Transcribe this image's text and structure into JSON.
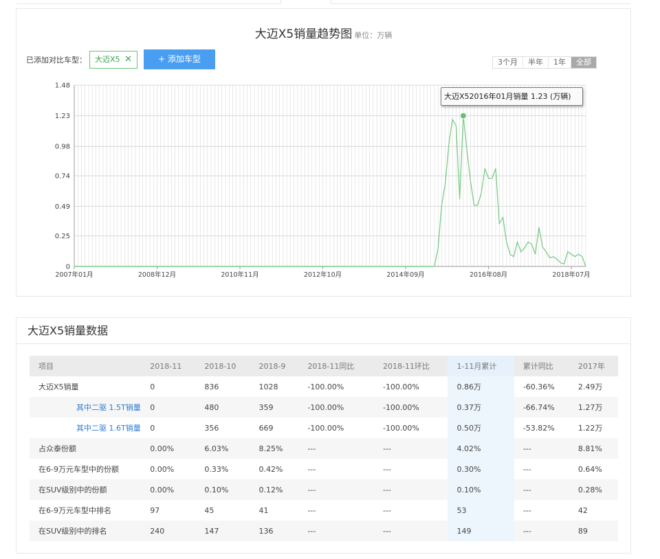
{
  "chart_header": {
    "title": "大迈X5销量趋势图",
    "unit": "单位：万辆",
    "compare_label": "已添加对比车型：",
    "tag_label": "大迈X5",
    "tag_close": "✕",
    "add_button": "+ 添加车型",
    "ranges": [
      "3个月",
      "半年",
      "1年",
      "全部"
    ]
  },
  "tooltip": "大迈X52016年01月销量 1.23 (万辆)",
  "chart_data": {
    "type": "line",
    "title": "大迈X5销量趋势图",
    "ylabel": "万辆",
    "ylim": [
      0,
      1.48
    ],
    "y_ticks": [
      "0",
      "0.25",
      "0.49",
      "0.74",
      "0.98",
      "1.23",
      "1.48"
    ],
    "y_tick_values": [
      0,
      0.25,
      0.49,
      0.74,
      0.98,
      1.23,
      1.48
    ],
    "x_ticks": [
      "2007年01月",
      "2008年12月",
      "2010年11月",
      "2012年10月",
      "2014年09月",
      "2016年08月",
      "2018年07月"
    ],
    "x_start": "2007-01",
    "x_end": "2018-11",
    "grid": true,
    "series": [
      {
        "name": "大迈X5",
        "color": "#7acb89",
        "points": [
          [
            "2015-05",
            0
          ],
          [
            "2015-06",
            0.15
          ],
          [
            "2015-07",
            0.5
          ],
          [
            "2015-08",
            0.68
          ],
          [
            "2015-09",
            1.0
          ],
          [
            "2015-10",
            1.2
          ],
          [
            "2015-11",
            1.15
          ],
          [
            "2015-12",
            0.55
          ],
          [
            "2016-01",
            1.23
          ],
          [
            "2016-02",
            0.95
          ],
          [
            "2016-03",
            0.7
          ],
          [
            "2016-04",
            0.5
          ],
          [
            "2016-05",
            0.5
          ],
          [
            "2016-06",
            0.6
          ],
          [
            "2016-07",
            0.8
          ],
          [
            "2016-08",
            0.72
          ],
          [
            "2016-09",
            0.72
          ],
          [
            "2016-10",
            0.8
          ],
          [
            "2016-11",
            0.35
          ],
          [
            "2016-12",
            0.4
          ],
          [
            "2017-01",
            0.2
          ],
          [
            "2017-02",
            0.1
          ],
          [
            "2017-03",
            0.08
          ],
          [
            "2017-04",
            0.2
          ],
          [
            "2017-05",
            0.12
          ],
          [
            "2017-06",
            0.15
          ],
          [
            "2017-07",
            0.2
          ],
          [
            "2017-08",
            0.18
          ],
          [
            "2017-09",
            0.1
          ],
          [
            "2017-10",
            0.32
          ],
          [
            "2017-11",
            0.16
          ],
          [
            "2017-12",
            0.12
          ],
          [
            "2018-01",
            0.07
          ],
          [
            "2018-02",
            0.08
          ],
          [
            "2018-03",
            0.06
          ],
          [
            "2018-04",
            0.03
          ],
          [
            "2018-05",
            0.02
          ],
          [
            "2018-06",
            0.12
          ],
          [
            "2018-07",
            0.1
          ],
          [
            "2018-08",
            0.08
          ],
          [
            "2018-09",
            0.1
          ],
          [
            "2018-10",
            0.08
          ],
          [
            "2018-11",
            0
          ]
        ]
      }
    ],
    "highlight": [
      "2016-01",
      1.23
    ]
  },
  "table_title": "大迈X5销量数据",
  "table": {
    "headers": [
      "项目",
      "2018-11",
      "2018-10",
      "2018-9",
      "2018-11同比",
      "2018-11环比",
      "1-11月累计",
      "累计同比",
      "2017年"
    ],
    "rows": [
      [
        "大迈X5销量",
        "0",
        "836",
        "1028",
        "-100.00%",
        "-100.00%",
        "0.86万",
        "-60.36%",
        "2.49万"
      ],
      [
        "其中二驱 1.5T销量",
        "0",
        "480",
        "359",
        "-100.00%",
        "-100.00%",
        "0.37万",
        "-66.74%",
        "1.27万"
      ],
      [
        "其中二驱 1.6T销量",
        "0",
        "356",
        "669",
        "-100.00%",
        "-100.00%",
        "0.50万",
        "-53.82%",
        "1.22万"
      ],
      [
        "占众泰份额",
        "0.00%",
        "6.03%",
        "8.25%",
        "---",
        "---",
        "4.02%",
        "---",
        "8.81%"
      ],
      [
        "在6-9万元车型中的份额",
        "0.00%",
        "0.33%",
        "0.42%",
        "---",
        "---",
        "0.30%",
        "---",
        "0.64%"
      ],
      [
        "在SUV级别中的份额",
        "0.00%",
        "0.10%",
        "0.12%",
        "---",
        "---",
        "0.10%",
        "---",
        "0.28%"
      ],
      [
        "在6-9万元车型中排名",
        "97",
        "45",
        "41",
        "---",
        "---",
        "53",
        "---",
        "42"
      ],
      [
        "在SUV级别中的排名",
        "240",
        "147",
        "136",
        "---",
        "---",
        "149",
        "---",
        "89"
      ]
    ]
  }
}
